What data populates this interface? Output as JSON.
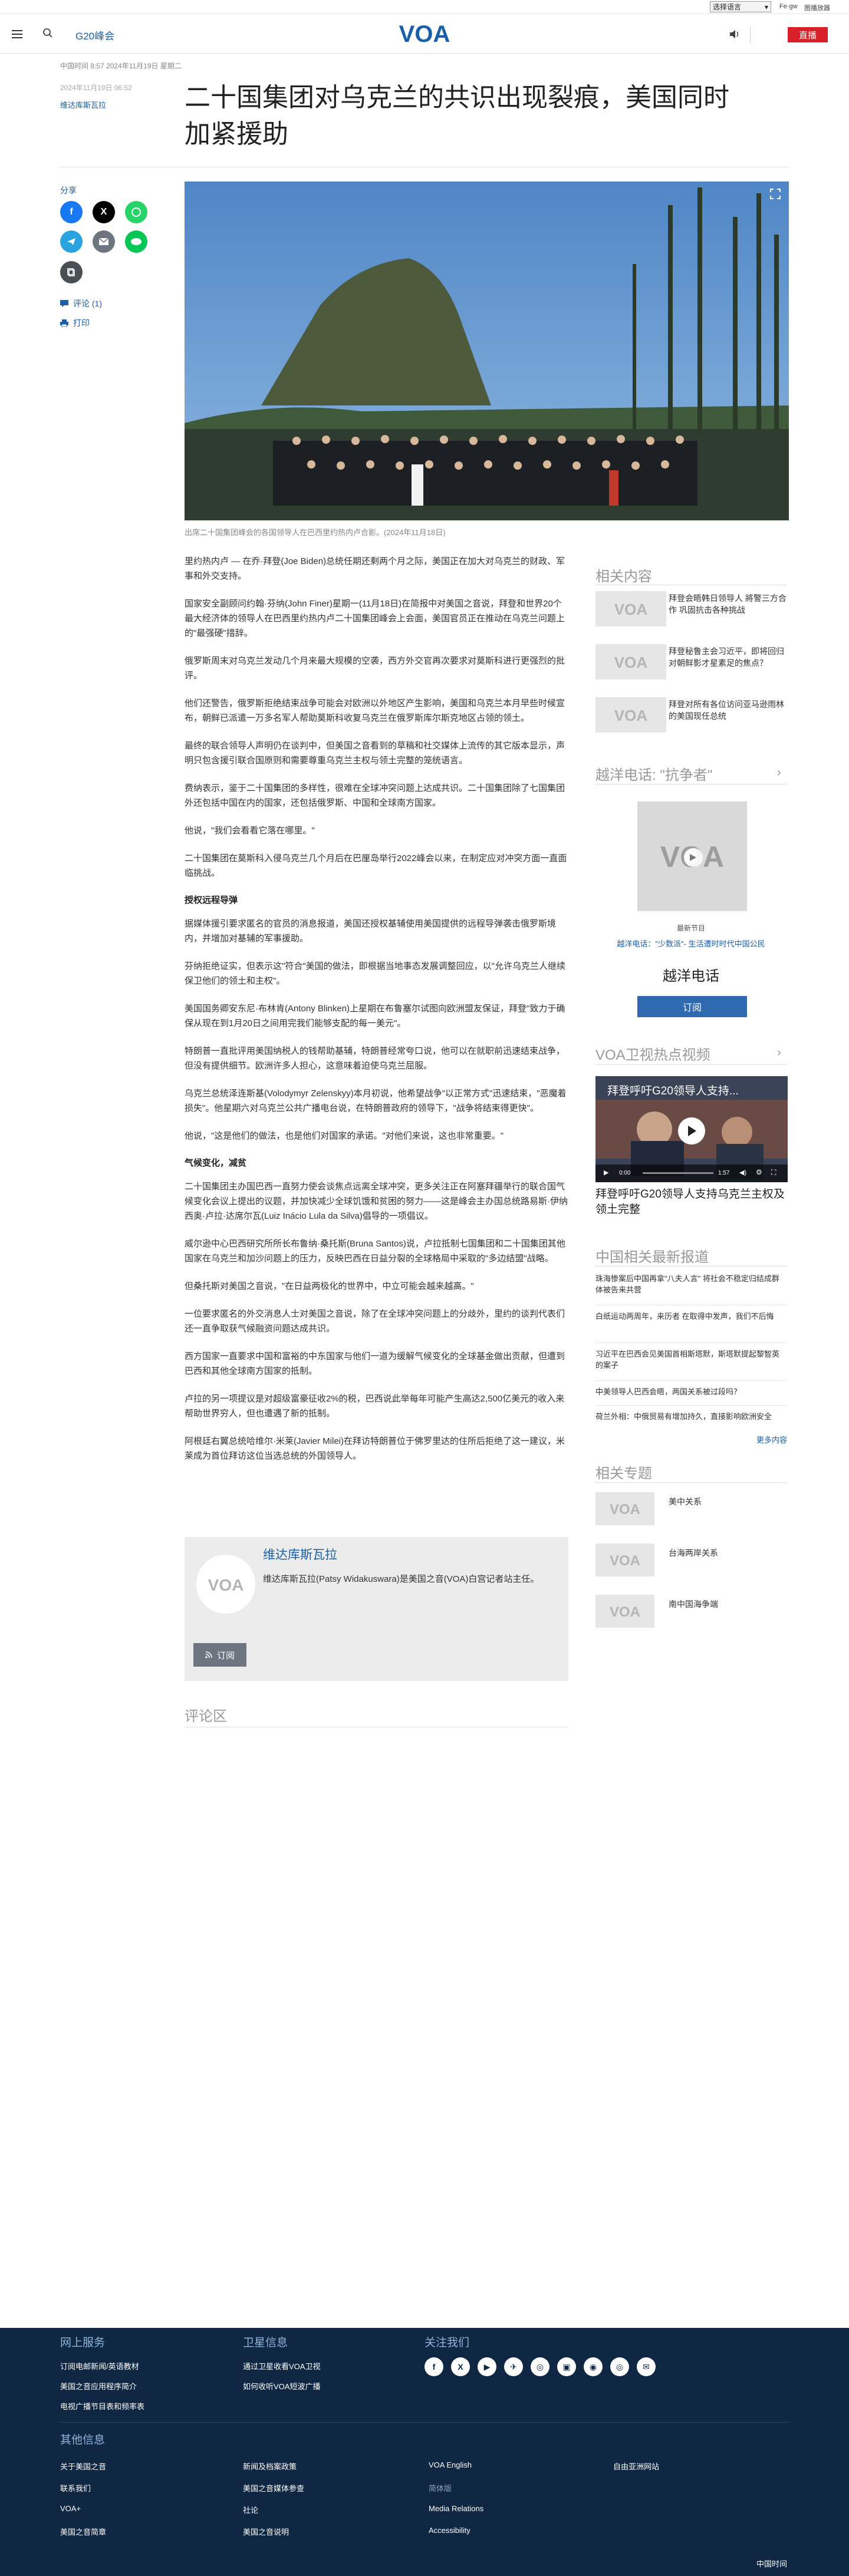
{
  "util": {
    "lang_select": "选择语言",
    "link_1": "Fe·gw",
    "link_2": "图播放器"
  },
  "header": {
    "section": "G20峰会",
    "logo": "VOA",
    "live": "直播"
  },
  "article": {
    "dates": "中国时间 8:57 2024年11月19日 星期二",
    "updated": "2024年11月19日 06:52",
    "author": "维达库斯瓦拉",
    "title_line1": "二十国集团对乌克兰的共识出现裂痕，美国同时",
    "title_line2": "加紧援助",
    "caption": "出席二十国集团峰会的各国领导人在巴西里约热内卢合影。(2024年11月18日)",
    "paragraphs": [
      "里约热内卢 — 在乔·拜登(Joe Biden)总统任期还剩两个月之际，美国正在加大对乌克兰的财政、军事和外交支持。",
      "国家安全副顾问约翰·芬纳(John Finer)星期一(11月18日)在简报中对美国之音说，拜登和世界20个最大经济体的领导人在巴西里约热内卢二十国集团峰会上会面，美国官员正在推动在乌克兰问题上的\"最强硬\"措辞。",
      "俄罗斯周末对乌克兰发动几个月来最大规模的空袭，西方外交官再次要求对莫斯科进行更强烈的批评。",
      "他们还警告，俄罗斯拒绝结束战争可能会对欧洲以外地区产生影响，美国和乌克兰本月早些时候宣布，朝鲜已派遣一万多名军人帮助莫斯科收复乌克兰在俄罗斯库尔斯克地区占领的领土。",
      "最终的联合领导人声明仍在谈判中，但美国之音看到的草稿和社交媒体上流传的其它版本显示，声明只包含援引联合国原则和需要尊重乌克兰主权与领土完整的笼统语言。",
      "费纳表示，鉴于二十国集团的多样性，很难在全球冲突问题上达成共识。二十国集团除了七国集团外还包括中国在内的国家，还包括俄罗斯、中国和全球南方国家。",
      "他说，\"我们会看看它落在哪里。\"",
      "二十国集团在莫斯科入侵乌克兰几个月后在巴厘岛举行2022峰会以来，在制定应对冲突方面一直面临挑战。"
    ],
    "h_longrange": "授权远程导弹",
    "paragraphs_2": [
      "据媒体援引要求匿名的官员的消息报道，美国还授权基辅使用美国提供的远程导弹袭击俄罗斯境内，并增加对基辅的军事援助。",
      "芬纳拒绝证实，但表示这\"符合\"美国的做法，即根据当地事态发展调整回应，以\"允许乌克兰人继续保卫他们的领土和主权\"。",
      "美国国务卿安东尼·布林肯(Antony Blinken)上星期在布鲁塞尔试图向欧洲盟友保证，拜登\"致力于确保从现在到1月20日之间用完我们能够支配的每一美元\"。",
      "特朗普一直批评用美国纳税人的钱帮助基辅，特朗普经常夸口说，他可以在就职前迅速结束战争，但没有提供细节。欧洲许多人担心，这意味着迫使乌克兰屈服。",
      "乌克兰总统泽连斯基(Volodymyr Zelenskyy)本月初说，他希望战争\"以正常方式\"迅速结束，\"恶魔着损失\"。他星期六对乌克兰公共广播电台说，在特朗普政府的领导下，\"战争将结束得更快\"。",
      "他说，\"这是他们的做法，也是他们对国家的承诺。\"对他们来说，这也非常重要。\""
    ],
    "h_climate": "气候变化，减贫",
    "paragraphs_3": [
      "二十国集团主办国巴西一直努力使会谈焦点远离全球冲突，更多关注正在阿塞拜疆举行的联合国气候变化会议上提出的议题，并加快减少全球饥饿和贫困的努力——这是峰会主办国总统路易斯·伊纳西奥·卢拉·达席尔瓦(Luiz Inácio Lula da Silva)倡导的一项倡议。",
      "威尔逊中心巴西研究所所长布鲁纳·桑托斯(Bruna Santos)说，卢拉抵制七国集团和二十国集团其他国家在乌克兰和加沙问题上的压力，反映巴西在日益分裂的全球格局中采取的\"多边结盟\"战略。",
      "但桑托斯对美国之音说，\"在日益两极化的世界中，中立可能会越来越高。\"",
      "一位要求匿名的外交消息人士对美国之音说，除了在全球冲突问题上的分歧外，里约的谈判代表们还一直争取获气候融资问题达成共识。",
      "西方国家一直要求中国和富裕的中东国家与他们一道为缓解气候变化的全球基金做出贡献，但遭到巴西和其他全球南方国家的抵制。",
      "卢拉的另一项提议是对超级富豪征收2%的税，巴西说此举每年可能产生高达2,500亿美元的收入来帮助世界穷人，但也遭遇了新的抵制。",
      "阿根廷右翼总统哈维尔·米莱(Javier Milei)在拜访特朗普位于佛罗里达的住所后拒绝了这一建议，米莱成为首位拜访这位当选总统的外国领导人。"
    ]
  },
  "share": {
    "label": "分享",
    "comments": "评论 (1)",
    "print": "打印"
  },
  "authorbox": {
    "name": "维达库斯瓦拉",
    "bio": "维达库斯瓦拉(Patsy Widakuswara)是美国之音(VOA)白宫记者站主任。",
    "subscribe": "订阅"
  },
  "comments": {
    "title": "评论区"
  },
  "sidebar": {
    "related_title": "相关内容",
    "related": [
      "拜登会晤韩日领导人 將警三方合作 巩固抗击各种挑战",
      "拜登秘鲁主会习近平，即将回归对朝鲜影才星素足的焦点？",
      "拜登对所有各位访问亚马逊雨林的美国现任总统"
    ],
    "radio_title": "越洋电话: \"抗争者\"",
    "radio_latest": "最新节目",
    "radio_episode": "越洋电话：\"少数派\"- 生活遭时时代中国公民",
    "radio_name": "越洋电话",
    "radio_subscribe": "订阅",
    "video_title": "VOA卫视热点视频",
    "video_overlay": "拜登呼吁G20领导人支持...",
    "video_caption": "拜登呼吁G20领导人支持乌克兰主权及领土完整",
    "video_time": "0:00",
    "video_duration": "1:57",
    "latest_title": "中国相关最新报道",
    "latest": [
      "珠海惨案后中国再拿\"八夫人言\" 将社会不稳定归结成群体被告来共营",
      "白纸运动两周年，来历者 在取得中发声，我们不后悔",
      "习近平在巴西会见美国首相斯塔默，斯塔默提起黎智英的案子",
      "中美领导人巴西会晤，两国关系被过段吗？",
      "荷兰外相：中俄贸易有增加持久，直接影响欧洲安全"
    ],
    "more": "更多内容",
    "topics_title": "相关专题",
    "topics": [
      "美中关系",
      "台海两岸关系",
      "南中国海争端"
    ]
  },
  "footer": {
    "col1_title": "网上服务",
    "col1": [
      "订阅电邮新闻/英语教材",
      "美国之音应用程序简介",
      "电视广播节目表和频率表"
    ],
    "col2_title": "卫星信息",
    "col2": [
      "通过卫星收看VOA卫视",
      "如何收听VOA短波广播"
    ],
    "col3_title": "关注我们",
    "social": [
      "f",
      "X",
      "▶",
      "✈",
      "◎",
      "▣",
      "◉",
      "◎",
      "✉"
    ],
    "other_title": "其他信息",
    "other": [
      [
        "关于美国之音",
        "新闻及档案政策",
        "VOA English",
        "自由亚洲网站"
      ],
      [
        "联系我们",
        "美国之音媒体参查",
        "简体版",
        ""
      ],
      [
        "VOA+",
        "社论",
        "Media Relations",
        ""
      ],
      [
        "美国之音简章",
        "美国之音说明",
        "Accessibility",
        ""
      ]
    ],
    "bottom": "中国时间"
  },
  "colors": {
    "brand_blue": "#1a5faa",
    "live_red": "#d61f26",
    "footer_bg": "#0f2742"
  }
}
